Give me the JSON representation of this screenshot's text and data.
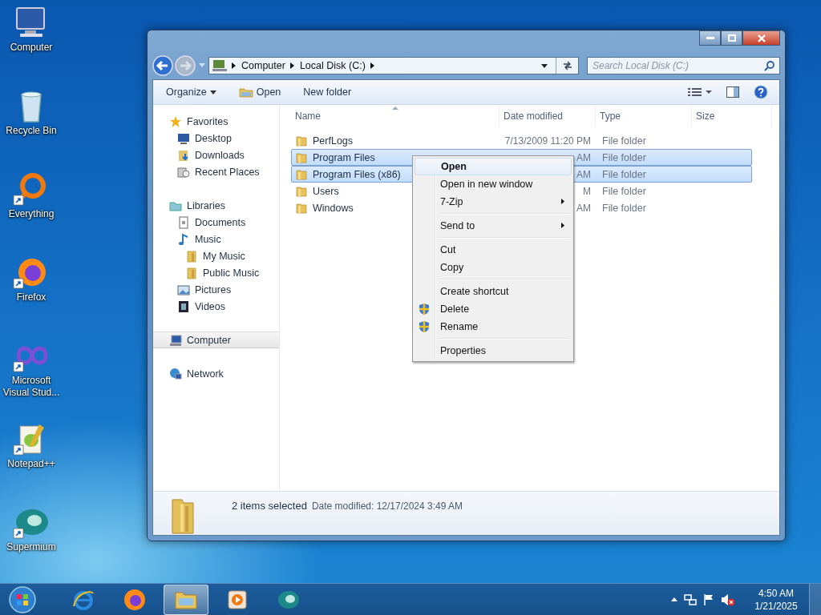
{
  "desktop_icons": [
    {
      "label": "Computer",
      "kind": "computer",
      "shortcut": false
    },
    {
      "label": "Recycle Bin",
      "kind": "recycle",
      "shortcut": false
    },
    {
      "label": "Everything",
      "kind": "ring",
      "shortcut": true
    },
    {
      "label": "Firefox",
      "kind": "firefox",
      "shortcut": true
    },
    {
      "label": "Microsoft Visual Stud...",
      "kind": "infinity",
      "shortcut": true
    },
    {
      "label": "Notepad++",
      "kind": "notepad",
      "shortcut": true
    },
    {
      "label": "Supermium",
      "kind": "supermium",
      "shortcut": true
    }
  ],
  "window": {
    "breadcrumb": [
      "Computer",
      "Local Disk (C:)"
    ],
    "search": {
      "placeholder": "Search Local Disk (C:)"
    },
    "toolbar": [
      {
        "label": "Organize",
        "kind": "menu"
      },
      {
        "label": "Open",
        "kind": "open"
      },
      {
        "label": "New folder",
        "kind": "plain"
      }
    ],
    "sidebar": [
      {
        "label": "Favorites",
        "kind": "star",
        "selected": false,
        "children": [
          {
            "label": "Desktop",
            "kind": "desktop",
            "selected": false
          },
          {
            "label": "Downloads",
            "kind": "downloads",
            "selected": false
          },
          {
            "label": "Recent Places",
            "kind": "recent",
            "selected": false
          }
        ]
      },
      {
        "label": "Libraries",
        "kind": "libraries",
        "selected": false,
        "children": [
          {
            "label": "Documents",
            "kind": "document",
            "selected": false
          },
          {
            "label": "Music",
            "kind": "music",
            "selected": false,
            "children": [
              {
                "label": "My Music",
                "kind": "folder",
                "selected": false
              },
              {
                "label": "Public Music",
                "kind": "folder",
                "selected": false
              }
            ]
          },
          {
            "label": "Pictures",
            "kind": "pictures",
            "selected": false
          },
          {
            "label": "Videos",
            "kind": "video",
            "selected": false
          }
        ]
      },
      {
        "label": "Computer",
        "kind": "computer",
        "selected": true
      },
      {
        "label": "Network",
        "kind": "network",
        "selected": false
      }
    ],
    "table": {
      "columns": [
        "Name",
        "Date modified",
        "Type",
        "Size"
      ],
      "rows": [
        {
          "name": "PerfLogs",
          "date_modified": "7/13/2009 11:20 PM",
          "type": "File folder",
          "selected": false
        },
        {
          "name": "Program Files",
          "date_modified": "AM",
          "type": "File folder",
          "selected": true
        },
        {
          "name": "Program Files (x86)",
          "date_modified": "AM",
          "type": "File folder",
          "selected": true
        },
        {
          "name": "Users",
          "date_modified": "M",
          "type": "File folder",
          "selected": false
        },
        {
          "name": "Windows",
          "date_modified": "AM",
          "type": "File folder",
          "selected": false
        }
      ]
    },
    "context_menu": {
      "items": [
        {
          "label": "Open",
          "kind": "default",
          "selected": true
        },
        {
          "label": "Open in new window",
          "kind": "item",
          "selected": false
        },
        {
          "label": "7-Zip",
          "kind": "submenu",
          "selected": false
        },
        {
          "kind": "separator"
        },
        {
          "label": "Send to",
          "kind": "submenu",
          "selected": false
        },
        {
          "kind": "separator"
        },
        {
          "label": "Cut",
          "kind": "item",
          "selected": false
        },
        {
          "label": "Copy",
          "kind": "item",
          "selected": false
        },
        {
          "kind": "separator"
        },
        {
          "label": "Create shortcut",
          "kind": "item",
          "selected": false
        },
        {
          "label": "Delete",
          "kind": "shield",
          "selected": false
        },
        {
          "label": "Rename",
          "kind": "shield",
          "selected": false
        },
        {
          "kind": "separator"
        },
        {
          "label": "Properties",
          "kind": "item",
          "selected": false
        }
      ]
    },
    "details_pane": {
      "summary": "2 items selected",
      "info": "Date modified: 12/17/2024 3:49 AM"
    }
  },
  "taskbar": {
    "apps": [
      {
        "kind": "browser",
        "selected": false
      },
      {
        "kind": "firefox",
        "selected": false
      },
      {
        "kind": "explorer",
        "selected": true
      },
      {
        "kind": "player",
        "selected": false
      },
      {
        "kind": "supermium",
        "selected": false
      }
    ],
    "clock": {
      "time": "4:50 AM",
      "date": "1/21/2025"
    }
  }
}
